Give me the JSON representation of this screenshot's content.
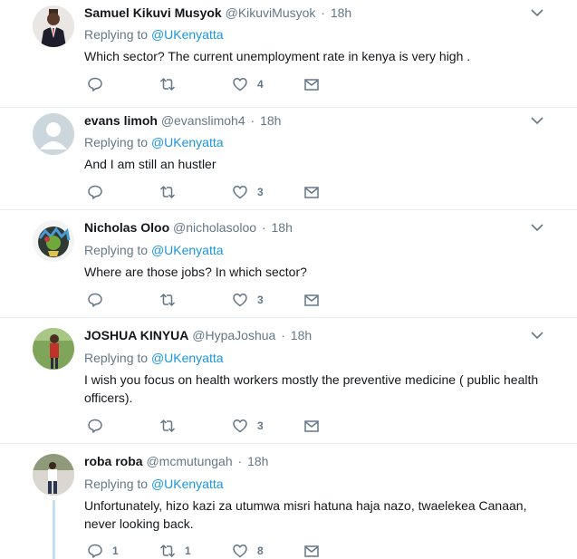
{
  "replying_label": "Replying to",
  "tweets": [
    {
      "name": "Samuel Kikuvi Musyok",
      "handle": "@KikuviMusyok",
      "time": "18h",
      "reply_to": "@UKenyatta",
      "text": "Which  sector?  The current unemployment rate in kenya is very high .",
      "replies": "",
      "retweets": "",
      "likes": "4"
    },
    {
      "name": "evans limoh",
      "handle": "@evanslimoh4",
      "time": "18h",
      "reply_to": "@UKenyatta",
      "text": "And I am still an hustler",
      "replies": "",
      "retweets": "",
      "likes": "3"
    },
    {
      "name": "Nicholas Oloo",
      "handle": "@nicholasoloo",
      "time": "18h",
      "reply_to": "@UKenyatta",
      "text": "Where are those jobs? In which sector?",
      "replies": "",
      "retweets": "",
      "likes": "3"
    },
    {
      "name": "JOSHUA KINYUA",
      "handle": "@HypaJoshua",
      "time": "18h",
      "reply_to": "@UKenyatta",
      "text": "I wish you focus on health workers mostly the preventive medicine ( public health officers).",
      "replies": "",
      "retweets": "",
      "likes": "3"
    },
    {
      "name": "roba roba",
      "handle": "@mcmutungah",
      "time": "18h",
      "reply_to": "@UKenyatta",
      "text": "Unfortunately, hizo kazi za utumwa misri hatuna haja nazo,  twaelekea Canaan, never looking back.",
      "replies": "1",
      "retweets": "1",
      "likes": "8"
    }
  ],
  "colors": {
    "text": "#14171a",
    "secondary": "#657786",
    "link": "#1b95e0",
    "divider": "#e6ecf0",
    "thread_line": "#c4dff5"
  },
  "icons": {
    "reply": "reply-icon",
    "retweet": "retweet-icon",
    "like": "heart-icon",
    "dm": "envelope-icon",
    "more": "chevron-down-icon"
  }
}
